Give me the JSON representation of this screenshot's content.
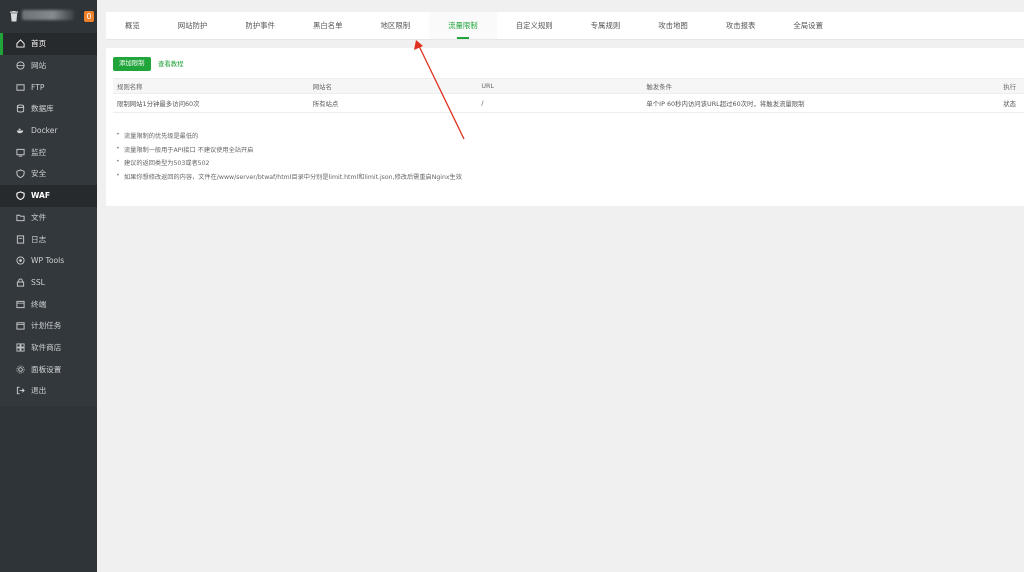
{
  "sidebar": {
    "badge": "0",
    "items": [
      {
        "label": "首页",
        "icon": "home-icon"
      },
      {
        "label": "网站",
        "icon": "globe-icon"
      },
      {
        "label": "FTP",
        "icon": "ftp-icon"
      },
      {
        "label": "数据库",
        "icon": "database-icon"
      },
      {
        "label": "Docker",
        "icon": "docker-icon"
      },
      {
        "label": "监控",
        "icon": "monitor-icon"
      },
      {
        "label": "安全",
        "icon": "shield-icon"
      },
      {
        "label": "WAF",
        "icon": "waf-shield-icon"
      },
      {
        "label": "文件",
        "icon": "folder-icon"
      },
      {
        "label": "日志",
        "icon": "log-icon"
      },
      {
        "label": "WP Tools",
        "icon": "wordpress-icon"
      },
      {
        "label": "SSL",
        "icon": "ssl-icon"
      },
      {
        "label": "终端",
        "icon": "terminal-icon"
      },
      {
        "label": "计划任务",
        "icon": "calendar-icon"
      },
      {
        "label": "软件商店",
        "icon": "store-icon"
      },
      {
        "label": "面板设置",
        "icon": "gear-icon"
      },
      {
        "label": "退出",
        "icon": "logout-icon"
      }
    ]
  },
  "tabs": [
    "概览",
    "网站防护",
    "防护事件",
    "黑白名单",
    "地区限制",
    "流量限制",
    "自定义规则",
    "专属规则",
    "攻击地图",
    "攻击报表",
    "全局设置"
  ],
  "active_tab": "流量限制",
  "panel": {
    "add_button": "添加限制",
    "view_tutorial": "查看教程",
    "table": {
      "headers": [
        "规则名称",
        "网站名",
        "URL",
        "触发条件",
        "执行"
      ],
      "rows": [
        [
          "限制网站1分钟最多访问60次",
          "所有站点",
          "/",
          "单个IP 60秒内访问该URL超过60次时，将触发流量限制",
          "状态"
        ]
      ]
    },
    "tips": [
      "流量限制的优先级是最低的",
      "流量限制一般用于API接口 不建议使用全站开启",
      "建议的返回类型为503或者502",
      "如果你想修改返回的内容，文件在/www/server/btwaf/html目录中分别是limit.html和limit.json,修改后需重启Nginx生效"
    ]
  },
  "colors": {
    "accent": "#20a53a",
    "sidebar_bg": "#2f3438",
    "annotation_arrow": "#e0301e",
    "badge": "#f0812b"
  }
}
